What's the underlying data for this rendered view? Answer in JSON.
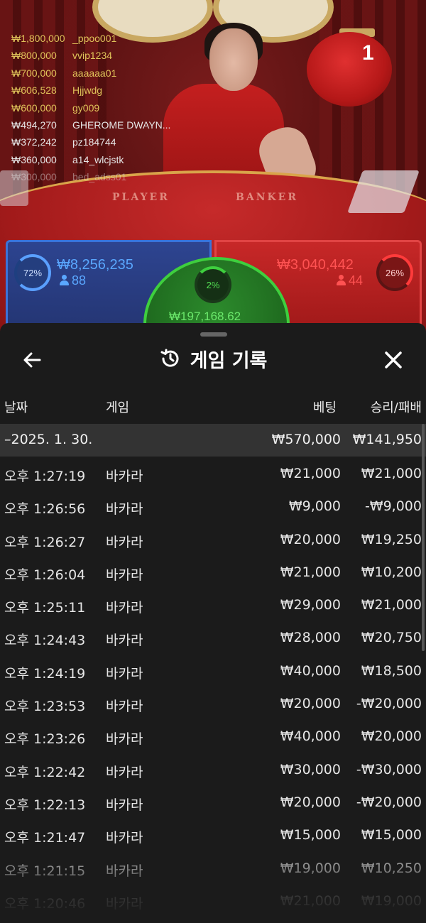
{
  "leaderboard": [
    {
      "amount": "₩1,800,000",
      "name": "_ppoo001",
      "tone": "gold"
    },
    {
      "amount": "₩800,000",
      "name": "vvip1234",
      "tone": "gold"
    },
    {
      "amount": "₩700,000",
      "name": "aaaaaa01",
      "tone": "gold"
    },
    {
      "amount": "₩606,528",
      "name": "Hjjwdg",
      "tone": "gold"
    },
    {
      "amount": "₩600,000",
      "name": "gy009",
      "tone": "gold"
    },
    {
      "amount": "₩494,270",
      "name": "GHEROME DWAYN...",
      "tone": "white"
    },
    {
      "amount": "₩372,242",
      "name": "pz184744",
      "tone": "white"
    },
    {
      "amount": "₩360,000",
      "name": "a14_wlcjstk",
      "tone": "white"
    },
    {
      "amount": "₩300,000",
      "name": "bed_adss01",
      "tone": "white fade"
    }
  ],
  "table": {
    "player_label": "PLAYER",
    "banker_label": "BANKER",
    "lantern_number": "1"
  },
  "bets": {
    "player": {
      "percent": "72%",
      "amount": "₩8,256,235",
      "count": "88",
      "color": "#3a73d9"
    },
    "banker": {
      "percent": "26%",
      "amount": "₩3,040,442",
      "count": "44",
      "color": "#e14444"
    },
    "tie": {
      "percent": "2%",
      "amount": "₩197,168.62",
      "color": "#3ecf3e"
    }
  },
  "sheet": {
    "title": "게임 기록",
    "columns": {
      "date": "날짜",
      "game": "게임",
      "bet": "베팅",
      "win": "승리/패배"
    },
    "summary": {
      "date": "–2025. 1. 30.",
      "bet": "₩570,000",
      "win": "₩141,950"
    },
    "rows": [
      {
        "time": "오후 1:27:19",
        "game": "바카라",
        "bet": "₩21,000",
        "win": "₩21,000"
      },
      {
        "time": "오후 1:26:56",
        "game": "바카라",
        "bet": "₩9,000",
        "win": "-₩9,000"
      },
      {
        "time": "오후 1:26:27",
        "game": "바카라",
        "bet": "₩20,000",
        "win": "₩19,250"
      },
      {
        "time": "오후 1:26:04",
        "game": "바카라",
        "bet": "₩21,000",
        "win": "₩10,200"
      },
      {
        "time": "오후 1:25:11",
        "game": "바카라",
        "bet": "₩29,000",
        "win": "₩21,000"
      },
      {
        "time": "오후 1:24:43",
        "game": "바카라",
        "bet": "₩28,000",
        "win": "₩20,750"
      },
      {
        "time": "오후 1:24:19",
        "game": "바카라",
        "bet": "₩40,000",
        "win": "₩18,500"
      },
      {
        "time": "오후 1:23:53",
        "game": "바카라",
        "bet": "₩20,000",
        "win": "-₩20,000"
      },
      {
        "time": "오후 1:23:26",
        "game": "바카라",
        "bet": "₩40,000",
        "win": "₩20,000"
      },
      {
        "time": "오후 1:22:42",
        "game": "바카라",
        "bet": "₩30,000",
        "win": "-₩30,000"
      },
      {
        "time": "오후 1:22:13",
        "game": "바카라",
        "bet": "₩20,000",
        "win": "-₩20,000"
      },
      {
        "time": "오후 1:21:47",
        "game": "바카라",
        "bet": "₩15,000",
        "win": "₩15,000"
      },
      {
        "time": "오후 1:21:15",
        "game": "바카라",
        "bet": "₩19,000",
        "win": "₩10,250"
      },
      {
        "time": "오후 1:20:46",
        "game": "바카라",
        "bet": "₩21,000",
        "win": "₩19,000"
      }
    ]
  },
  "icons": {
    "back": "arrow-left-icon",
    "history": "history-clock-icon",
    "close": "close-icon",
    "person": "person-icon"
  }
}
